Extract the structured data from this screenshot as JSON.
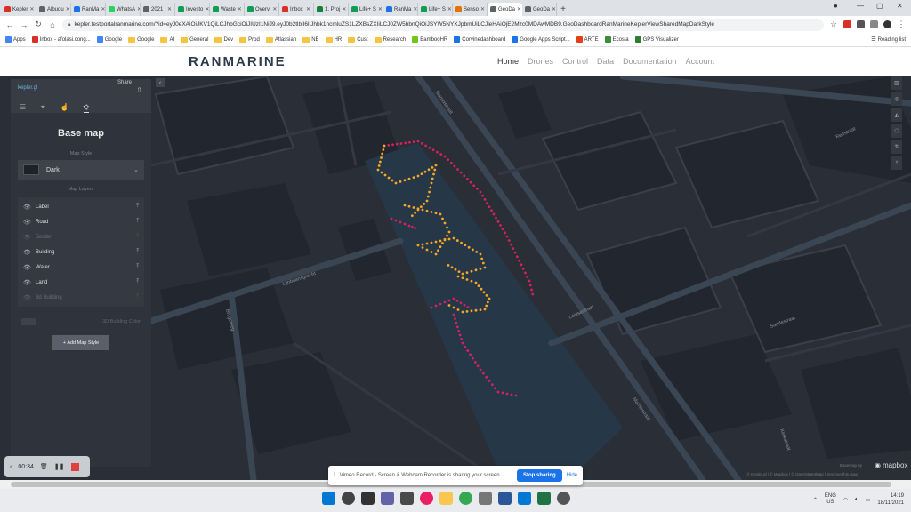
{
  "browser": {
    "tabs": [
      {
        "label": "Kepler",
        "color": "#d93025"
      },
      {
        "label": "Albuqu",
        "color": "#5f6368"
      },
      {
        "label": "RanMa",
        "color": "#1a73e8"
      },
      {
        "label": "WhatsA",
        "color": "#25d366"
      },
      {
        "label": "2021",
        "color": "#5f6368"
      },
      {
        "label": "Investo",
        "color": "#0f9d58"
      },
      {
        "label": "Waste",
        "color": "#0f9d58"
      },
      {
        "label": "Overvi",
        "color": "#0f9d58"
      },
      {
        "label": "Inbox",
        "color": "#d93025"
      },
      {
        "label": "1. Proj",
        "color": "#188038"
      },
      {
        "label": "Life+ S",
        "color": "#0f9d58"
      },
      {
        "label": "RanMa",
        "color": "#1a73e8"
      },
      {
        "label": "Life+ S",
        "color": "#0f9d58"
      },
      {
        "label": "Senso",
        "color": "#e37400"
      },
      {
        "label": "GeoDa",
        "color": "#5f6368",
        "active": true
      },
      {
        "label": "GeoDa",
        "color": "#5f6368"
      }
    ],
    "new_tab": "+",
    "url": "kepler.testportalranmarine.com/?id=eyJ0eXAiOiJKV1QiLCJhbGciOiJIUzI1NiJ9.eyJ0b2tlbiI6IlJhbk1hcmluZS1LZXBsZXIiLCJ0ZW5hbnQiOiJSYW5NYXJpbmUiLCJleHAiOjE2Mzc0MDAwMDB9.GeoDashboardRanMarineKeplerViewSharedMapDarkStyle",
    "bookmarks": [
      {
        "label": "Apps",
        "kind": "apps"
      },
      {
        "label": "Inbox - afolasi.cong...",
        "kind": "gmail"
      },
      {
        "label": "Google",
        "kind": "google"
      },
      {
        "label": "Google",
        "kind": "folder"
      },
      {
        "label": "AI",
        "kind": "folder"
      },
      {
        "label": "General",
        "kind": "folder"
      },
      {
        "label": "Dev",
        "kind": "folder"
      },
      {
        "label": "Prod",
        "kind": "folder"
      },
      {
        "label": "Atlassian",
        "kind": "folder"
      },
      {
        "label": "NB",
        "kind": "folder"
      },
      {
        "label": "HR",
        "kind": "folder"
      },
      {
        "label": "Cust",
        "kind": "folder"
      },
      {
        "label": "Research",
        "kind": "folder"
      },
      {
        "label": "BambooHR",
        "kind": "bamboo"
      },
      {
        "label": "Corvinedashboard",
        "kind": "site"
      },
      {
        "label": "Google Apps Script...",
        "kind": "script"
      },
      {
        "label": "ARTE",
        "kind": "arte"
      },
      {
        "label": "Ecosia",
        "kind": "ecosia"
      },
      {
        "label": "GPS Visualizer",
        "kind": "gps"
      }
    ],
    "reading_list": "Reading list"
  },
  "site": {
    "logo": "RANMARINE",
    "menu": [
      "Home",
      "Drones",
      "Control",
      "Data",
      "Documentation",
      "Account"
    ]
  },
  "panel": {
    "share_label": "Share",
    "brand": "kepler.gl",
    "title": "Base map",
    "map_style_header": "Map Style",
    "map_style_value": "Dark",
    "map_layers_header": "Map Layers",
    "layers": [
      {
        "label": "Label",
        "visible": true
      },
      {
        "label": "Road",
        "visible": true
      },
      {
        "label": "Border",
        "visible": false
      },
      {
        "label": "Building",
        "visible": true
      },
      {
        "label": "Water",
        "visible": true
      },
      {
        "label": "Land",
        "visible": true
      },
      {
        "label": "3d Building",
        "visible": false
      }
    ],
    "building_color_label": "3D Building Color",
    "add_style_button": "+ Add Map Style"
  },
  "recorder": {
    "time": "00:34"
  },
  "map": {
    "street_labels": [
      "Marnixstraat",
      "Singel",
      "Nassaukade",
      "Lijnbaansgracht",
      "Leidsestraat",
      "Reestraat",
      "Spinnekop",
      "Kerkstraat",
      "Brugsteeg",
      "Hazenstraat",
      "Sandestraat"
    ],
    "attribution": "© Kepler.gl | © Mapbox | © OpenStreetMap | Improve this map",
    "powered_by": "Basemap by",
    "mapbox_label": "mapbox"
  },
  "vimeo_bar": {
    "message": "Vimeo Record - Screen & Webcam Recorder is sharing your screen.",
    "stop_button": "Stop sharing",
    "hide_button": "Hide"
  },
  "taskbar": {
    "lang_top": "ENG",
    "lang_bottom": "US",
    "time": "14:19",
    "date": "18/11/2021"
  },
  "colors": {
    "accent_magenta": "#d0235f",
    "accent_orange": "#f5a623"
  }
}
